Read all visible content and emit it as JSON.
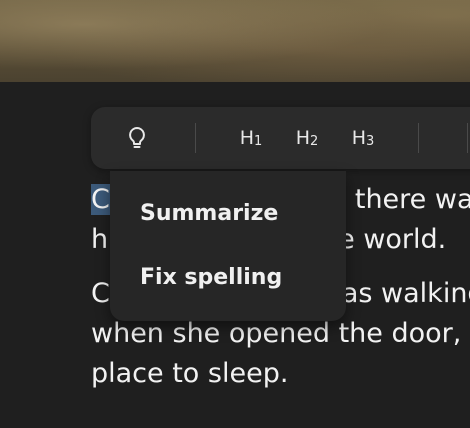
{
  "toolbar": {
    "ai_icon": "lightbulb-icon",
    "heading1": "H1",
    "heading2": "H2",
    "heading3": "H3"
  },
  "ai_menu": {
    "items": [
      "Summarize",
      "Fix spelling"
    ]
  },
  "editor": {
    "line1_start": "C",
    "line1_end": "there wa",
    "line2_start": "h",
    "line2_end": "e world.",
    "line3_start": "C",
    "line3_end": "as walking",
    "line4": "when she opened the door,",
    "line5": "place to sleep."
  }
}
